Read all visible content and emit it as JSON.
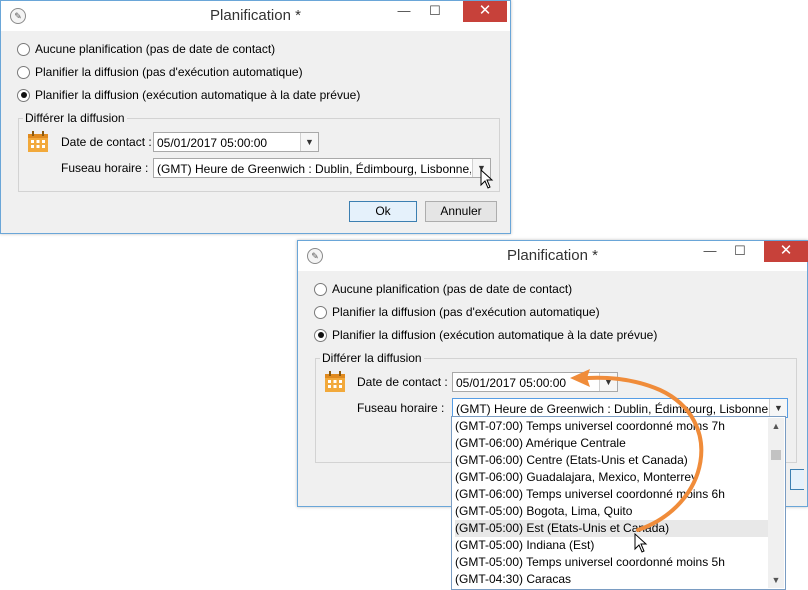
{
  "dialog1": {
    "title": "Planification *",
    "window_controls": {
      "minimize": "—",
      "maximize": "☐",
      "close": "✕"
    },
    "radio_options": [
      {
        "label": "Aucune planification (pas de date de contact)",
        "checked": false
      },
      {
        "label": "Planifier la diffusion (pas d'exécution automatique)",
        "checked": false
      },
      {
        "label": "Planifier la diffusion (exécution automatique à la date prévue)",
        "checked": true
      }
    ],
    "group_label": "Différer la diffusion",
    "contact_date_label": "Date de contact :",
    "contact_date_value": "05/01/2017 05:00:00",
    "timezone_label": "Fuseau horaire :",
    "timezone_value": "(GMT) Heure de Greenwich : Dublin, Édimbourg, Lisbonne, L",
    "ok_label": "Ok",
    "cancel_label": "Annuler"
  },
  "dialog2": {
    "title": "Planification *",
    "window_controls": {
      "minimize": "—",
      "maximize": "☐",
      "close": "✕"
    },
    "radio_options": [
      {
        "label": "Aucune planification (pas de date de contact)",
        "checked": false
      },
      {
        "label": "Planifier la diffusion (pas d'exécution automatique)",
        "checked": false
      },
      {
        "label": "Planifier la diffusion (exécution automatique à la date prévue)",
        "checked": true
      }
    ],
    "group_label": "Différer la diffusion",
    "contact_date_label": "Date de contact :",
    "contact_date_value": "05/01/2017 05:00:00",
    "timezone_label": "Fuseau horaire :",
    "timezone_value": "(GMT) Heure de Greenwich : Dublin, Édimbourg, Lisbonne, L",
    "timezone_options": [
      "(GMT-07:00) Temps universel coordonné moins 7h",
      "(GMT-06:00) Amérique Centrale",
      "(GMT-06:00) Centre (Etats-Unis et Canada)",
      "(GMT-06:00) Guadalajara, Mexico, Monterrey",
      "(GMT-06:00) Temps universel coordonné moins 6h",
      "(GMT-05:00) Bogota, Lima, Quito",
      "(GMT-05:00) Est (Etats-Unis et Canada)",
      "(GMT-05:00) Indiana (Est)",
      "(GMT-05:00) Temps universel coordonné moins 5h",
      "(GMT-04:30) Caracas"
    ],
    "highlighted_option_index": 6
  },
  "colors": {
    "accent": "#3c7fb1",
    "close_button": "#c7413a",
    "arrow": "#f08c3a",
    "calendar": "#f2a93b"
  }
}
